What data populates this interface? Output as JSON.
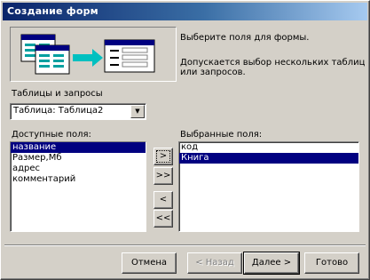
{
  "window": {
    "title": "Создание форм"
  },
  "description": {
    "line1": "Выберите поля для формы.",
    "line2": "Допускается выбор нескольких таблиц или запросов."
  },
  "tables": {
    "label": "Таблицы и запросы",
    "selected": "Таблица: Таблица2"
  },
  "available": {
    "label": "Доступные поля:",
    "items": [
      "название",
      "Размер,Мб",
      "адрес",
      "комментарий"
    ]
  },
  "selected_fields": {
    "label": "Выбранные поля:",
    "items": [
      "код",
      "Книга"
    ]
  },
  "move_buttons": {
    "add_one": ">",
    "add_all": ">>",
    "remove_one": "<",
    "remove_all": "<<"
  },
  "buttons": {
    "cancel": "Отмена",
    "back": "< Назад",
    "next": "Далее >",
    "finish": "Готово"
  },
  "colors": {
    "title_start": "#0a246a",
    "title_end": "#a6caf0",
    "selection": "#000080",
    "face": "#d4d0c8"
  }
}
